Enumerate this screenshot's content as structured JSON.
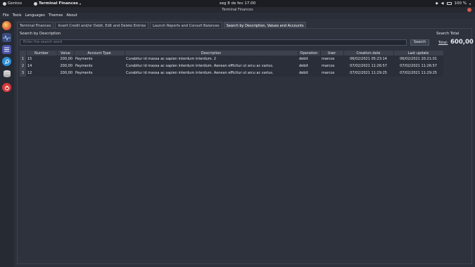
{
  "topbar": {
    "activities": "Gentoo",
    "app_name": "Terminal Finances",
    "clock": "seg 8 de fev  17:00",
    "battery": "100 %"
  },
  "window": {
    "title": "Terminal Finances"
  },
  "menu": {
    "items": [
      "File",
      "Tools",
      "Languages",
      "Themes",
      "About"
    ]
  },
  "dock": {
    "icons": [
      "finances-app-icon",
      "transactions-icon",
      "reports-icon",
      "search-icon",
      "database-icon",
      "power-icon"
    ]
  },
  "tabs": [
    {
      "label": "Terminal Finances",
      "active": false
    },
    {
      "label": "Insert Credit and/or Debit, Edit and Delete Entries",
      "active": false
    },
    {
      "label": "Launch Reports and Consult Balances",
      "active": false
    },
    {
      "label": "Search by Description, Values and Accounts",
      "active": true
    }
  ],
  "search": {
    "label": "Search by Description",
    "placeholder": "Enter the search word",
    "button": "Search"
  },
  "total": {
    "title": "Search Total",
    "label": "Total:",
    "value": "600,00"
  },
  "table": {
    "columns": [
      "Number",
      "Value",
      "Account Type",
      "Description",
      "Operation",
      "User",
      "Creation date",
      "Last update"
    ],
    "rows": [
      {
        "n": "1",
        "number": "15",
        "value": "200,00",
        "account": "Payments",
        "description": "Curabitur id massa ac sapien interdum interdum.  2",
        "operation": "debit",
        "user": "marcos",
        "created": "06/02/2021 05:23:14",
        "updated": "06/02/2021 20:21:01"
      },
      {
        "n": "2",
        "number": "14",
        "value": "200,00",
        "account": "Payments",
        "description": "Curabitur id massa ac sapien interdum interdum. Aenean efficitur ut arcu ac varius.",
        "operation": "debit",
        "user": "marcos",
        "created": "07/02/2021 11:26:57",
        "updated": "07/02/2021 11:26:57"
      },
      {
        "n": "3",
        "number": "12",
        "value": "200,00",
        "account": "Payments",
        "description": "Curabitur id massa ac sapien interdum interdum. Aenean efficitur ut arcu ac varius.",
        "operation": "debit",
        "user": "marcos",
        "created": "07/02/2021 11:29:25",
        "updated": "07/02/2021 11:29:25"
      }
    ]
  },
  "colors": {
    "accent_close": "#d65a4c",
    "background": "#2d313c",
    "header": "#3c414d"
  }
}
